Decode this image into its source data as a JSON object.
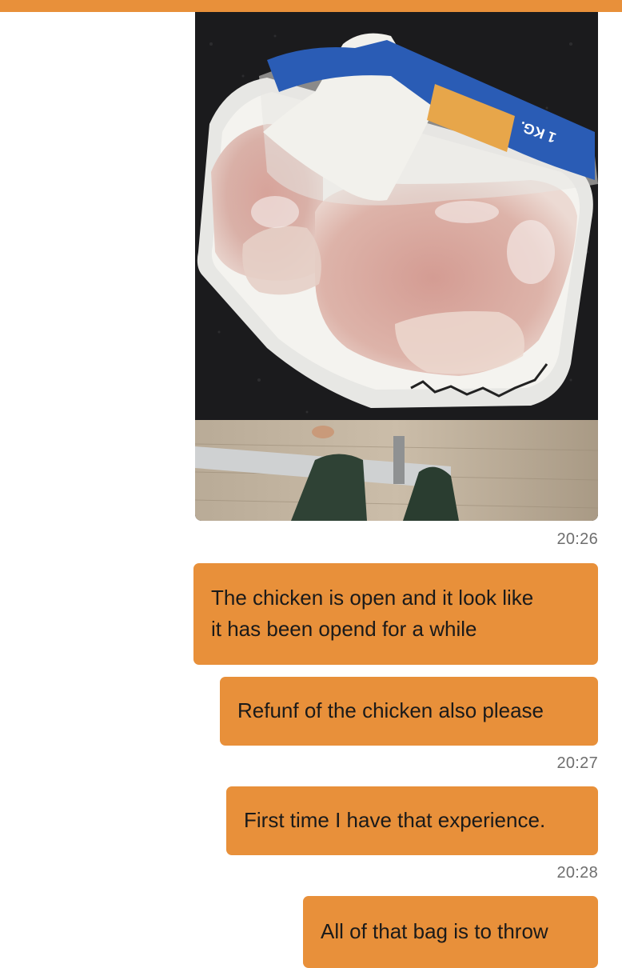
{
  "theme": {
    "accent": "#e8903a",
    "timestamp_color": "#6e6e6e",
    "background": "#ffffff"
  },
  "chat": {
    "photo": {
      "subject": "frozen-chicken-in-opened-tray",
      "label_text": "1 KG."
    },
    "messages": [
      {
        "time": "20:26",
        "text": "The chicken is open and it look like\nit has been opend for a while"
      },
      {
        "text": "Refunf of the chicken also please"
      },
      {
        "time": "20:27",
        "text": "First time I have that experience."
      },
      {
        "time": "20:28",
        "text": "All of that bag is to throw"
      }
    ]
  }
}
